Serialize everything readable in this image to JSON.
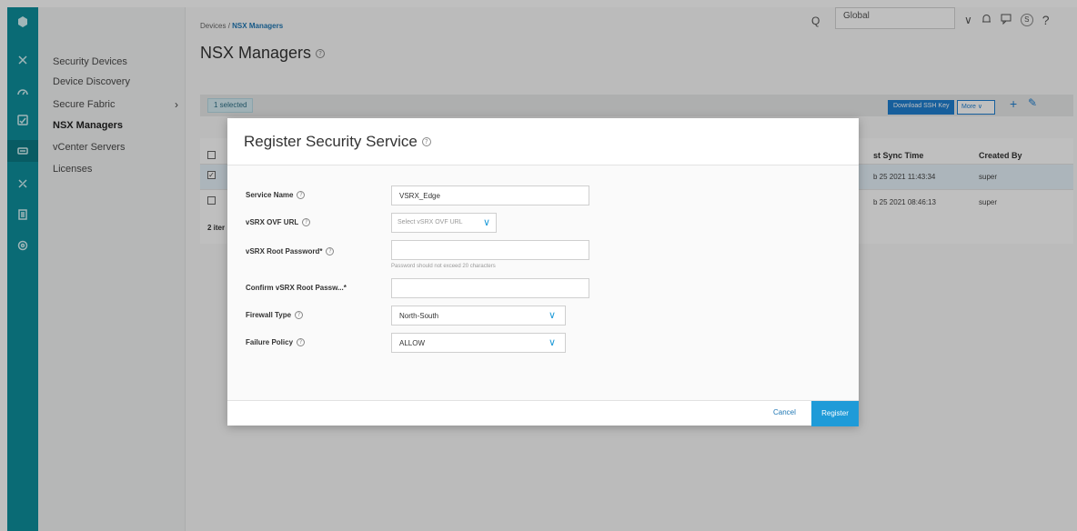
{
  "colors": {
    "rail": "#0e8f9c",
    "primary": "#1f7fd1",
    "register": "#1f9bd8"
  },
  "rail_icons": [
    "logo-icon",
    "close-icon",
    "dashboard-icon",
    "monitor-icon",
    "devices-icon",
    "tools-icon",
    "document-icon",
    "settings-icon"
  ],
  "subnav": {
    "items": [
      {
        "label": "Security Devices"
      },
      {
        "label": "Device Discovery"
      },
      {
        "label": "Secure Fabric",
        "chevron": "›"
      },
      {
        "label": "NSX Managers"
      },
      {
        "label": "vCenter Servers"
      },
      {
        "label": "Licenses"
      }
    ]
  },
  "breadcrumb": {
    "parent": "Devices",
    "sep": "/",
    "current": "NSX Managers"
  },
  "page": {
    "title": "NSX Managers",
    "help": "?"
  },
  "topbar": {
    "search_glyph": "Q",
    "scope": "Global",
    "scope_chevron": "∨",
    "user_initial": "S",
    "help": "?"
  },
  "toolbar": {
    "selected": "1 selected",
    "download_ssh": "Download SSH Key",
    "more": "More ∨",
    "add": "+",
    "edit": "✎"
  },
  "table": {
    "headers": {
      "sync": "st Sync Time",
      "created": "Created By"
    },
    "rows": [
      {
        "checked": true,
        "sync": "b 25 2021 11:43:34",
        "created": "super"
      },
      {
        "checked": false,
        "sync": "b 25 2021 08:46:13",
        "created": "super"
      }
    ],
    "count": "2 iter"
  },
  "modal": {
    "title": "Register Security Service",
    "fields": {
      "service_name": {
        "label": "Service Name",
        "value": "VSRX_Edge"
      },
      "ovf_url": {
        "label": "vSRX OVF URL",
        "placeholder": "Select vSRX OVF URL"
      },
      "root_pw": {
        "label": "vSRX Root Password*",
        "hint": "Password should not exceed 20 characters"
      },
      "confirm_pw": {
        "label": "Confirm vSRX Root Passw...*"
      },
      "firewall_type": {
        "label": "Firewall Type",
        "value": "North-South"
      },
      "failure_policy": {
        "label": "Failure Policy",
        "value": "ALLOW"
      }
    },
    "cancel": "Cancel",
    "register": "Register"
  }
}
